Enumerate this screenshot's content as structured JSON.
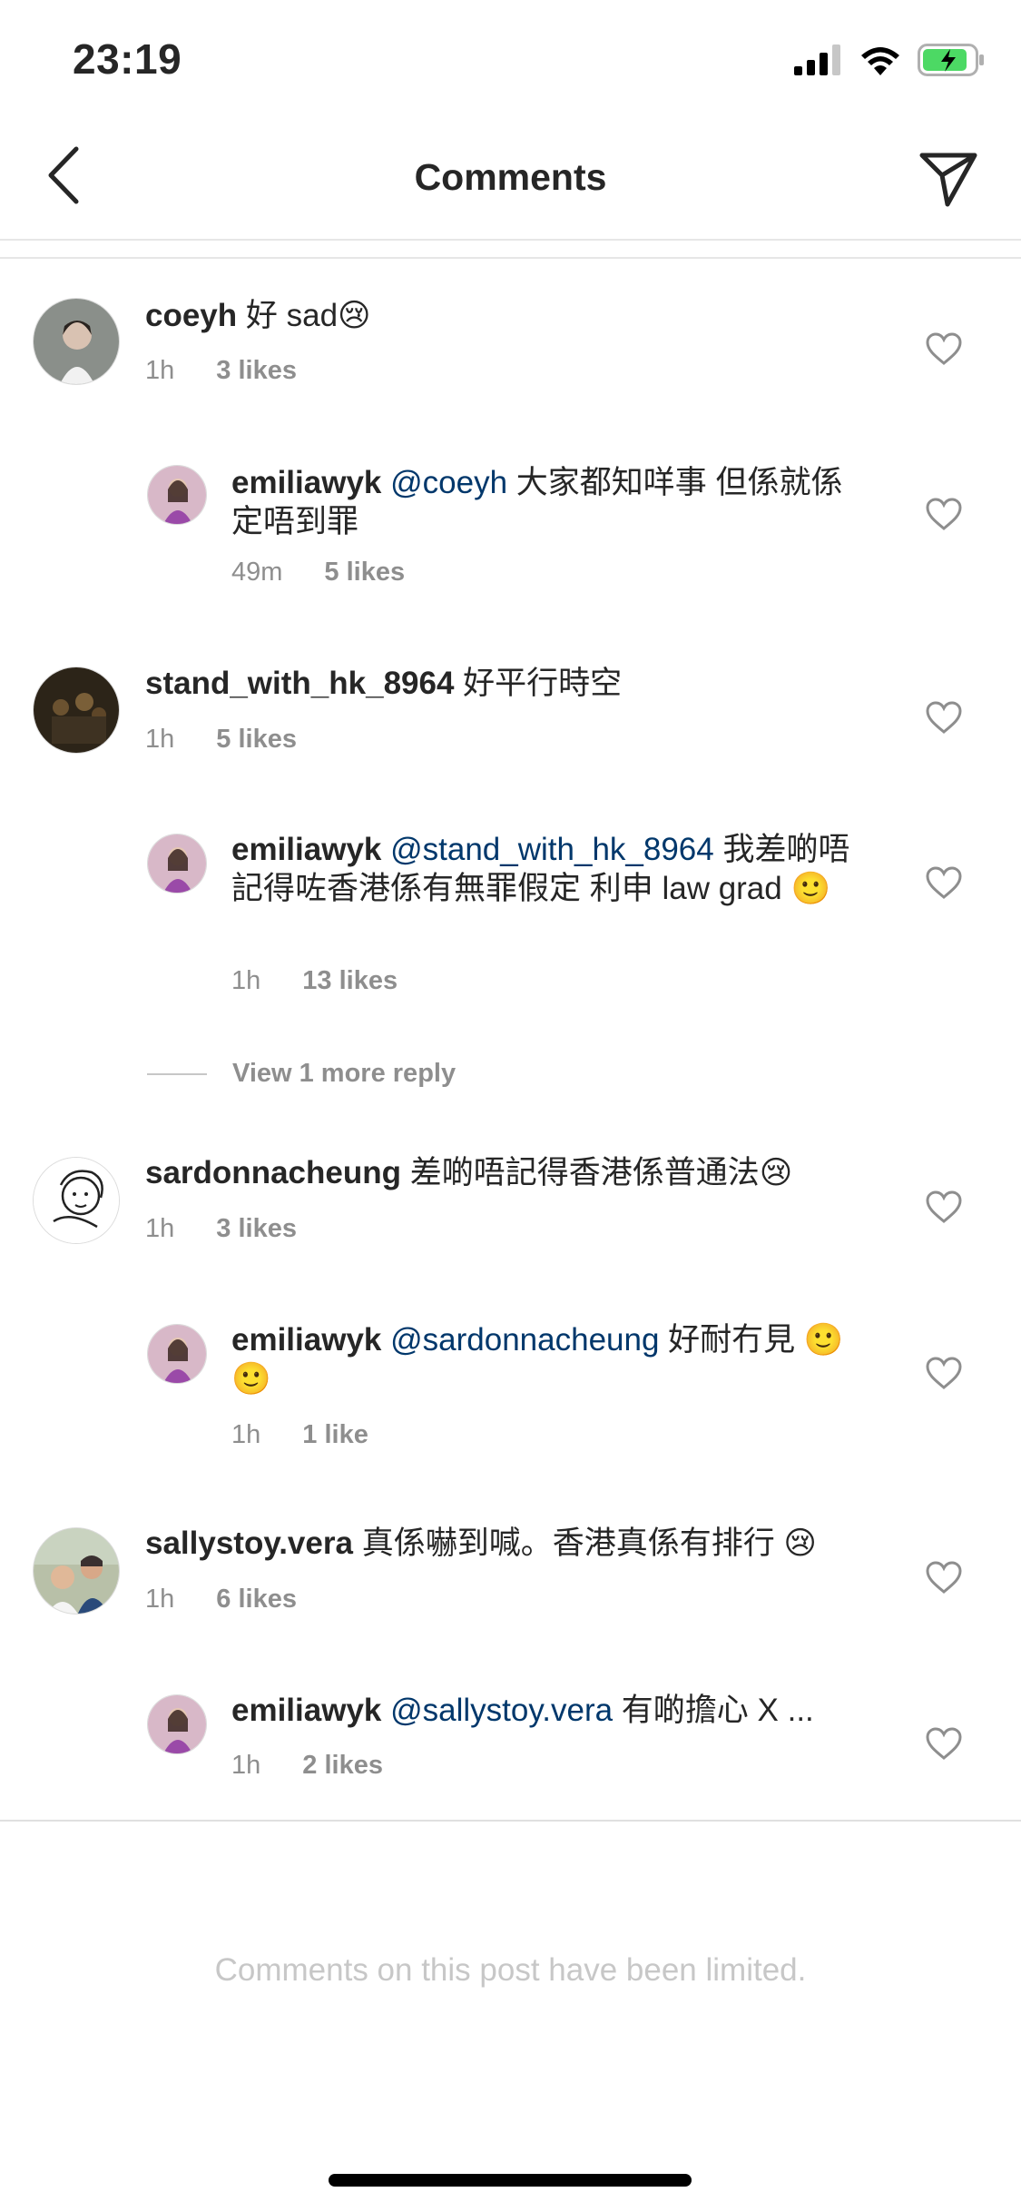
{
  "status_bar": {
    "time": "23:19"
  },
  "header": {
    "title": "Comments"
  },
  "comments": [
    {
      "username": "coeyh",
      "text": "好 sad😢",
      "time": "1h",
      "likes": "3 likes",
      "reply": {
        "username": "emiliawyk",
        "mention": "@coeyh",
        "text": " 大家都知咩事 但係就係定唔到罪",
        "time": "49m",
        "likes": "5 likes"
      }
    },
    {
      "username": "stand_with_hk_8964",
      "text": "好平行時空",
      "time": "1h",
      "likes": "5 likes",
      "reply": {
        "username": "emiliawyk",
        "mention": "@stand_with_hk_8964",
        "text": " 我差啲唔記得咗香港係有無罪假定 利申 law grad 🙂",
        "time": "1h",
        "likes": "13 likes"
      }
    },
    {
      "username": "sardonnacheung",
      "text": "差啲唔記得香港係普通法😢",
      "time": "1h",
      "likes": "3 likes",
      "reply": {
        "username": "emiliawyk",
        "mention": "@sardonnacheung",
        "text": " 好耐冇見 🙂🙂",
        "time": "1h",
        "likes": "1 like"
      }
    },
    {
      "username": "sallystoy.vera",
      "text": "真係嚇到喊。香港真係有排行 😢",
      "time": "1h",
      "likes": "6 likes",
      "reply": {
        "username": "emiliawyk",
        "mention": "@sallystoy.vera",
        "text": " 有啲擔心 X ...",
        "time": "1h",
        "likes": "2 likes"
      }
    }
  ],
  "view_more_replies": "View 1 more reply",
  "footer": {
    "limited_notice": "Comments on this post have been limited."
  },
  "colors": {
    "mention": "#00376b",
    "meta": "#8e8e8e",
    "text": "#262626",
    "battery": "#4cd964"
  },
  "icons": [
    "back-chevron-icon",
    "send-icon",
    "heart-icon",
    "signal-icon",
    "wifi-icon",
    "battery-icon"
  ]
}
